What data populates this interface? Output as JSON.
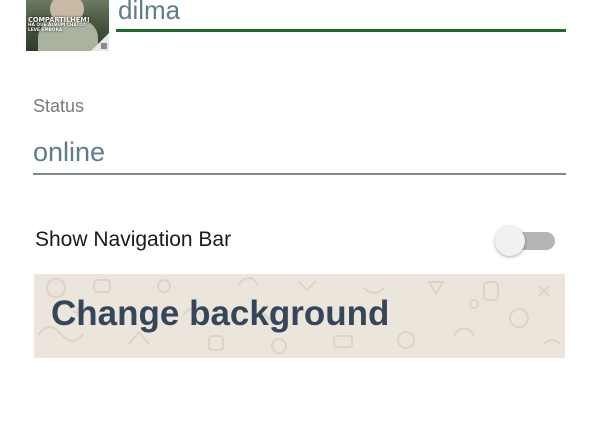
{
  "profile": {
    "avatar_caption_main": "COMPARTILHEM!",
    "avatar_caption_sub1": "HÁ QUE ÁLBUM CHATO?",
    "avatar_caption_sub2": "LEVE EMBORA",
    "name_value": "dilma"
  },
  "status": {
    "label": "Status",
    "value": "online"
  },
  "settings": {
    "navigation_bar_label": "Show Navigation Bar",
    "navigation_bar_enabled": false
  },
  "background": {
    "button_label": "Change background",
    "panel_color": "#ece5dc"
  },
  "colors": {
    "accent_green": "#1f6b2a",
    "field_text": "#5e7d8a",
    "title_text": "#35465a"
  }
}
